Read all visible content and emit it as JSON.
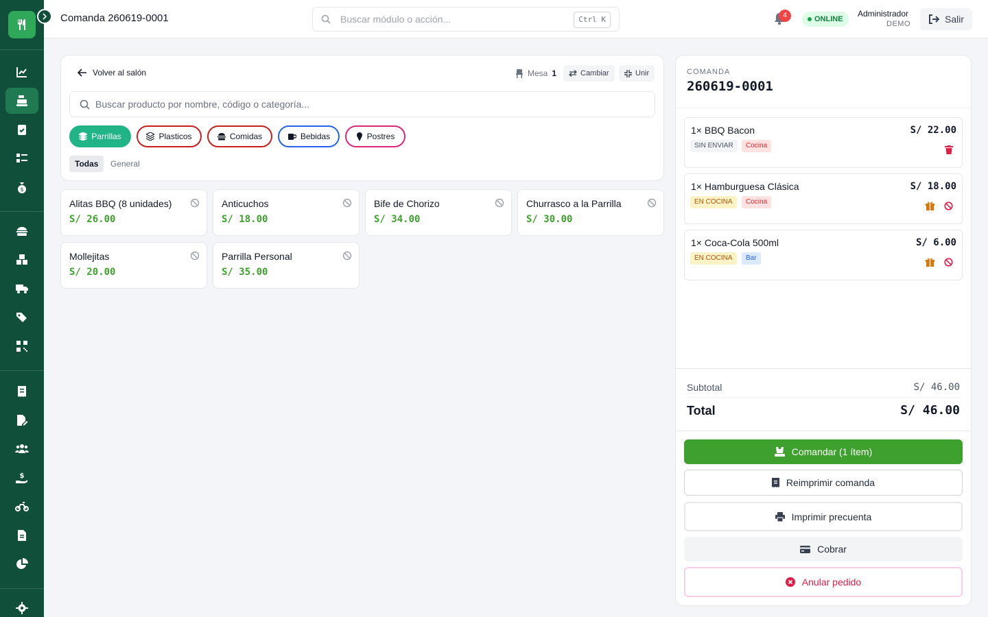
{
  "topbar": {
    "title": "Comanda 260619-0001",
    "search_placeholder": "Buscar módulo o acción...",
    "shortcut": "Ctrl K",
    "notifications_count": "4",
    "status": "ONLINE",
    "user_name": "Administrador",
    "user_role": "DEMO",
    "logout_label": "Salir"
  },
  "sidebar": {
    "items": [
      {
        "icon": "chart-line-icon"
      },
      {
        "icon": "cash-register-icon",
        "active": true
      },
      {
        "icon": "clipboard-check-icon"
      },
      {
        "icon": "list-check-icon"
      },
      {
        "icon": "money-bag-icon"
      },
      {
        "icon": "burger-icon"
      },
      {
        "icon": "boxes-icon"
      },
      {
        "icon": "truck-icon"
      },
      {
        "icon": "tags-icon"
      },
      {
        "icon": "qrcode-icon"
      },
      {
        "icon": "receipt-icon"
      },
      {
        "icon": "file-signature-icon"
      },
      {
        "icon": "users-icon"
      },
      {
        "icon": "hand-dollar-icon"
      },
      {
        "icon": "motorcycle-icon"
      },
      {
        "icon": "file-icon"
      },
      {
        "icon": "pie-chart-icon"
      },
      {
        "icon": "gear-icon"
      }
    ]
  },
  "products": {
    "back_label": "Volver al salón",
    "mesa_label": "Mesa",
    "mesa_number": "1",
    "change_label": "Cambiar",
    "join_label": "Unir",
    "search_placeholder": "Buscar producto por nombre, código o categoría...",
    "categories": [
      {
        "label": "Parrillas",
        "color": "#20b486",
        "selected": true
      },
      {
        "label": "Plasticos",
        "color": "#c81e1e"
      },
      {
        "label": "Comidas",
        "color": "#c81e1e"
      },
      {
        "label": "Bebidas",
        "color": "#2563eb"
      },
      {
        "label": "Postres",
        "color": "#db2777"
      }
    ],
    "subcategories": [
      "Todas",
      "General"
    ],
    "items": [
      {
        "name": "Alitas BBQ (8 unidades)",
        "price": "S/ 26.00"
      },
      {
        "name": "Anticuchos",
        "price": "S/ 18.00"
      },
      {
        "name": "Bife de Chorizo",
        "price": "S/ 34.00"
      },
      {
        "name": "Churrasco a la Parrilla",
        "price": "S/ 30.00"
      },
      {
        "name": "Mollejitas",
        "price": "S/ 20.00"
      },
      {
        "name": "Parrilla Personal",
        "price": "S/ 35.00"
      }
    ]
  },
  "order": {
    "label": "COMANDA",
    "number": "260619-0001",
    "items": [
      {
        "name": "1× BBQ Bacon",
        "price": "S/ 22.00",
        "status": "SIN ENVIAR",
        "station": "Cocina"
      },
      {
        "name": "1× Hamburguesa Clásica",
        "price": "S/ 18.00",
        "status": "EN COCINA",
        "station": "Cocina"
      },
      {
        "name": "1× Coca-Cola 500ml",
        "price": "S/ 6.00",
        "status": "EN COCINA",
        "station": "Bar"
      }
    ],
    "subtotal_label": "Subtotal",
    "subtotal": "S/ 46.00",
    "total_label": "Total",
    "total": "S/ 46.00",
    "buttons": {
      "comandar": "Comandar (1 ítem)",
      "reimprimir": "Reimprimir comanda",
      "precuenta": "Imprimir precuenta",
      "cobrar": "Cobrar",
      "anular": "Anular pedido"
    }
  },
  "colors": {
    "sidebar": "#10503a",
    "accent_green": "#3ea12e",
    "brand_green": "#2fa85a",
    "danger": "#e11d48"
  }
}
